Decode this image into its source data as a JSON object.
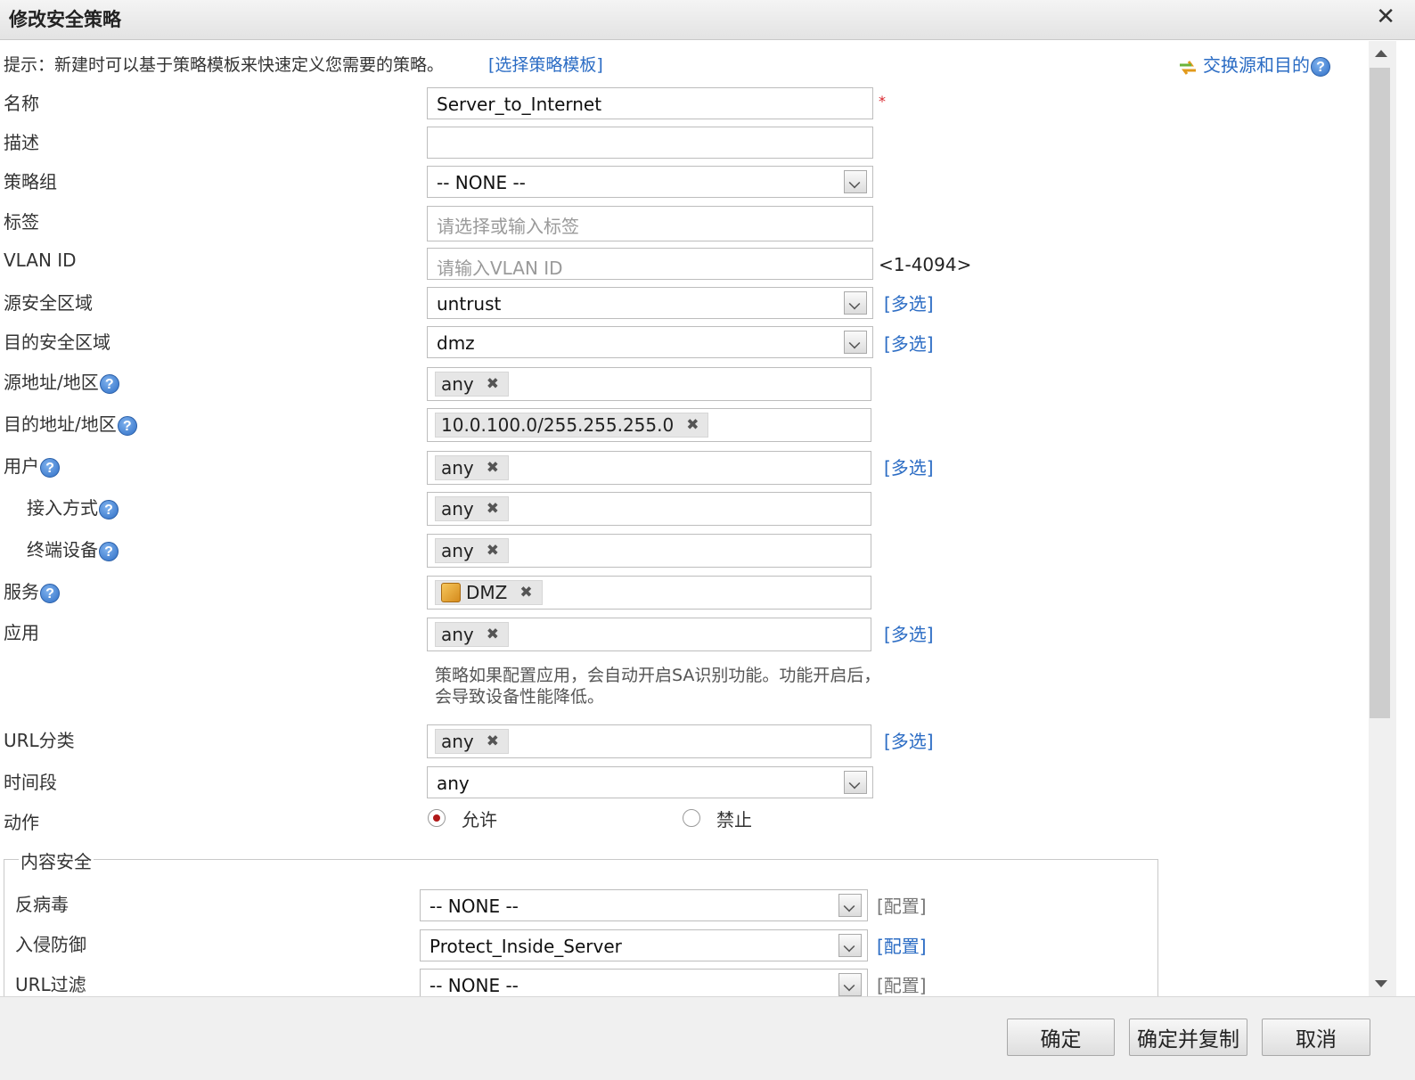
{
  "dialog": {
    "title": "修改安全策略",
    "close_label": "✕"
  },
  "hint": {
    "text": "提示：新建时可以基于策略模板来快速定义您需要的策略。",
    "template_link": "[选择策略模板]",
    "swap_link": "交换源和目的"
  },
  "form": {
    "name_label": "名称",
    "name_value": "Server_to_Internet",
    "required_mark": "*",
    "desc_label": "描述",
    "desc_value": "",
    "group_label": "策略组",
    "group_value": "-- NONE --",
    "tag_label": "标签",
    "tag_placeholder": "请选择或输入标签",
    "vlan_label": "VLAN ID",
    "vlan_placeholder": "请输入VLAN ID",
    "vlan_range": "<1-4094>",
    "src_zone_label": "源安全区域",
    "src_zone_value": "untrust",
    "dst_zone_label": "目的安全区域",
    "dst_zone_value": "dmz",
    "multi_label": "[多选]",
    "src_addr_label": "源地址/地区",
    "src_addr_tag": "any",
    "dst_addr_label": "目的地址/地区",
    "dst_addr_tag": "10.0.100.0/255.255.255.0",
    "user_label": "用户",
    "user_tag": "any",
    "access_label": "接入方式",
    "access_tag": "any",
    "terminal_label": "终端设备",
    "terminal_tag": "any",
    "service_label": "服务",
    "service_tag": "DMZ",
    "app_label": "应用",
    "app_tag": "any",
    "app_note": "策略如果配置应用，会自动开启SA识别功能。功能开启后，会导致设备性能降低。",
    "url_cat_label": "URL分类",
    "url_cat_tag": "any",
    "time_label": "时间段",
    "time_value": "any",
    "action_label": "动作",
    "action_allow": "允许",
    "action_deny": "禁止",
    "action_selected": "允许",
    "tag_remove": "✖",
    "help_glyph": "?"
  },
  "content_security": {
    "legend": "内容安全",
    "config_label": "[配置]",
    "antivirus_label": "反病毒",
    "antivirus_value": "-- NONE --",
    "ips_label": "入侵防御",
    "ips_value": "Protect_Inside_Server",
    "url_filter_label": "URL过滤",
    "url_filter_value": "-- NONE --"
  },
  "footer": {
    "ok": "确定",
    "ok_copy": "确定并复制",
    "cancel": "取消"
  },
  "colors": {
    "link": "#2b6cc4",
    "required": "#d9242b",
    "radio_selected": "#b01818"
  }
}
